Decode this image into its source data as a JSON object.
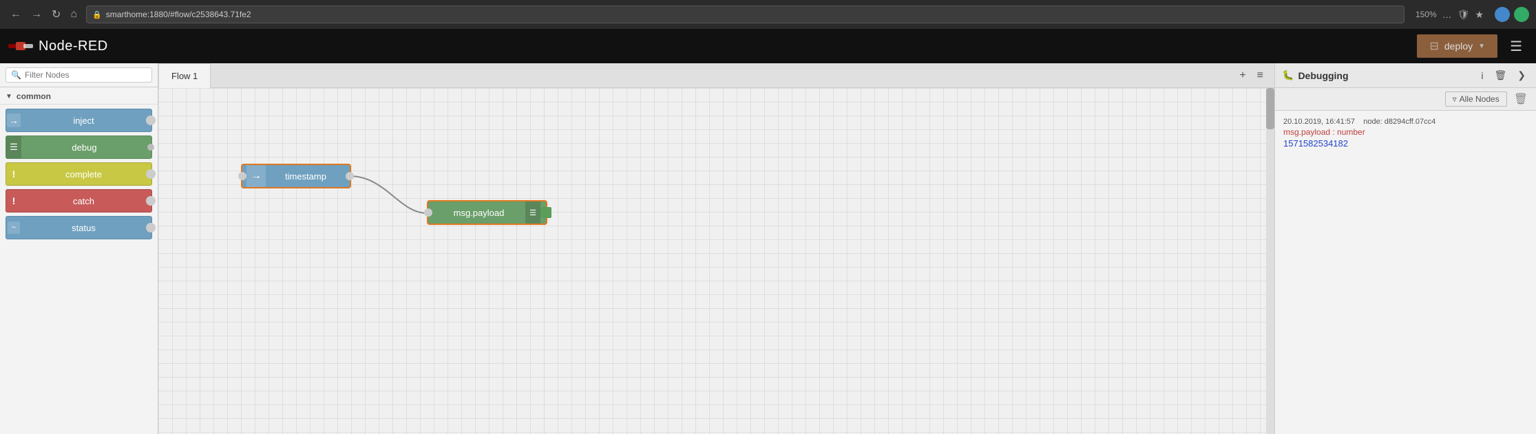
{
  "browser": {
    "url": "smarthome:1880/#flow/c2538643.71fe2",
    "zoom": "150%",
    "security_icon": "🔒"
  },
  "topbar": {
    "title": "Node-RED",
    "deploy_label": "deploy",
    "deploy_icon": "▼"
  },
  "sidebar": {
    "filter_placeholder": "Filter Nodes",
    "section_label": "common",
    "nodes": [
      {
        "id": "inject",
        "label": "inject",
        "type": "inject",
        "icon": "→"
      },
      {
        "id": "debug",
        "label": "debug",
        "type": "debug",
        "icon": "≡"
      },
      {
        "id": "complete",
        "label": "complete",
        "type": "complete",
        "icon": "!"
      },
      {
        "id": "catch",
        "label": "catch",
        "type": "catch",
        "icon": "!"
      },
      {
        "id": "status",
        "label": "status",
        "type": "status",
        "icon": "~"
      }
    ]
  },
  "canvas": {
    "tab_label": "Flow 1",
    "add_tab_icon": "+",
    "list_icon": "≡",
    "nodes": [
      {
        "id": "timestamp",
        "label": "timestamp",
        "type": "inject"
      },
      {
        "id": "msgpayload",
        "label": "msg.payload",
        "type": "debug"
      }
    ]
  },
  "debugging": {
    "title": "Debugging",
    "filter_label": "Alle Nodes",
    "info_icon": "i",
    "bug_icon": "🐛",
    "clear_icon": "🗑",
    "entries": [
      {
        "timestamp": "20.10.2019, 16:41:57",
        "node_label": "node: d8294cff.07cc4",
        "type_label": "msg.payload : number",
        "value": "1571582534182"
      }
    ]
  }
}
